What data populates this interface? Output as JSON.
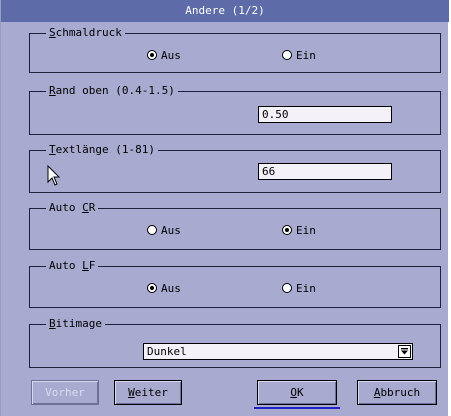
{
  "dialog": {
    "title": "Andere (1/2)"
  },
  "schmaldruck": {
    "legend_prefix": "S",
    "legend_rest": "chmaldruck",
    "options": [
      {
        "label": "Aus",
        "selected": true
      },
      {
        "label": "Ein",
        "selected": false
      }
    ]
  },
  "rand_oben": {
    "legend_prefix": "R",
    "legend_rest": "and oben (0.4-1.5)",
    "value": "0.50"
  },
  "textlaenge": {
    "legend_prefix": "T",
    "legend_rest": "extlänge (1-81)",
    "value": "66"
  },
  "auto_cr": {
    "legend_pre": "Auto ",
    "legend_u": "C",
    "legend_post": "R",
    "options": [
      {
        "label": "Aus",
        "selected": false
      },
      {
        "label": "Ein",
        "selected": true
      }
    ]
  },
  "auto_lf": {
    "legend_pre": "Auto ",
    "legend_u": "L",
    "legend_post": "F",
    "options": [
      {
        "label": "Aus",
        "selected": true
      },
      {
        "label": "Ein",
        "selected": false
      }
    ]
  },
  "bitimage": {
    "legend_prefix": "B",
    "legend_rest": "itimage",
    "selected": "Dunkel"
  },
  "buttons": {
    "vorher": "Vorher",
    "weiter_u": "W",
    "weiter_rest": "eiter",
    "ok_u": "O",
    "ok_rest": "K",
    "abbruch_u": "A",
    "abbruch_rest": "bbruch"
  }
}
